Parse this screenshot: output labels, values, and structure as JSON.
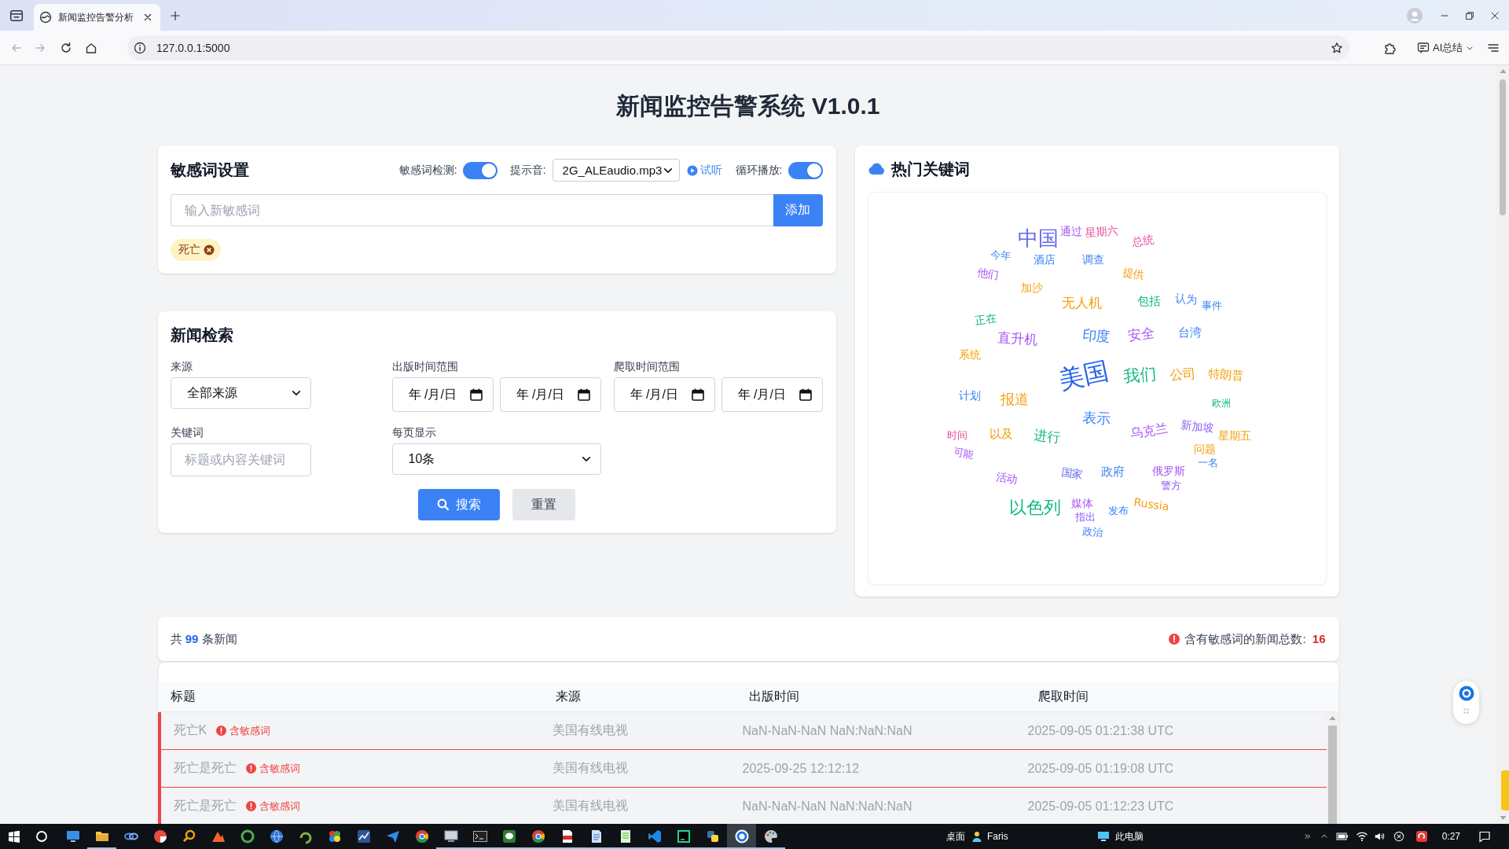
{
  "browser": {
    "tabs": [
      {
        "title": "新闻监控告警分析",
        "selected": true
      }
    ],
    "address": "127.0.0.1:5000",
    "ai_button": "AI总结"
  },
  "page_title": "新闻监控告警系统 V1.0.1",
  "sensitive_settings": {
    "title": "敏感词设置",
    "detection": {
      "label": "敏感词检测:",
      "on": true
    },
    "sound": {
      "label": "提示音:",
      "value": "2G_ALEaudio.mp3"
    },
    "preview": "试听",
    "loop": {
      "label": "循环播放:",
      "on": true
    },
    "new_word": {
      "placeholder": "输入新敏感词"
    },
    "add_button": "添加",
    "tags": [
      "死亡"
    ]
  },
  "hot_keywords": {
    "title": "热门关键词",
    "words": [
      {
        "text": "中国",
        "color": "#6366f1"
      },
      {
        "text": "通过",
        "color": "#a855f7"
      },
      {
        "text": "星期六",
        "color": "#ec4899"
      },
      {
        "text": "总统",
        "color": "#ec4899"
      },
      {
        "text": "今年",
        "color": "#3b82f6"
      },
      {
        "text": "酒店",
        "color": "#3b82f6"
      },
      {
        "text": "调查",
        "color": "#3b82f6"
      },
      {
        "text": "他们",
        "color": "#a855f7"
      },
      {
        "text": "提供",
        "color": "#f59e0b"
      },
      {
        "text": "加沙",
        "color": "#f59e0b"
      },
      {
        "text": "无人机",
        "color": "#f59e0b"
      },
      {
        "text": "包括",
        "color": "#10b981"
      },
      {
        "text": "认为",
        "color": "#3b82f6"
      },
      {
        "text": "事件",
        "color": "#3b82f6"
      },
      {
        "text": "正在",
        "color": "#10b981"
      },
      {
        "text": "直升机",
        "color": "#a855f7"
      },
      {
        "text": "印度",
        "color": "#3b82f6"
      },
      {
        "text": "安全",
        "color": "#a855f7"
      },
      {
        "text": "台湾",
        "color": "#3b82f6"
      },
      {
        "text": "系统",
        "color": "#f59e0b"
      },
      {
        "text": "美国",
        "color": "#2563eb"
      },
      {
        "text": "我们",
        "color": "#10b981"
      },
      {
        "text": "公司",
        "color": "#f59e0b"
      },
      {
        "text": "特朗普",
        "color": "#f59e0b"
      },
      {
        "text": "计划",
        "color": "#3b82f6"
      },
      {
        "text": "报道",
        "color": "#f59e0b"
      },
      {
        "text": "欧洲",
        "color": "#10b981"
      },
      {
        "text": "表示",
        "color": "#3b82f6"
      },
      {
        "text": "时间",
        "color": "#ec4899"
      },
      {
        "text": "以及",
        "color": "#f59e0b"
      },
      {
        "text": "进行",
        "color": "#10b981"
      },
      {
        "text": "乌克兰",
        "color": "#a855f7"
      },
      {
        "text": "新加坡",
        "color": "#8b5cf6"
      },
      {
        "text": "星期五",
        "color": "#f59e0b"
      },
      {
        "text": "可能",
        "color": "#a855f7"
      },
      {
        "text": "问题",
        "color": "#f59e0b"
      },
      {
        "text": "一名",
        "color": "#3b82f6"
      },
      {
        "text": "活动",
        "color": "#a855f7"
      },
      {
        "text": "国家",
        "color": "#6366f1"
      },
      {
        "text": "政府",
        "color": "#3b82f6"
      },
      {
        "text": "俄罗斯",
        "color": "#a855f7"
      },
      {
        "text": "警方",
        "color": "#8b5cf6"
      },
      {
        "text": "以色列",
        "color": "#10b981"
      },
      {
        "text": "媒体",
        "color": "#a855f7"
      },
      {
        "text": "发布",
        "color": "#3b82f6"
      },
      {
        "text": "Russia",
        "color": "#f59e0b"
      },
      {
        "text": "指出",
        "color": "#8b5cf6"
      },
      {
        "text": "政治",
        "color": "#3b82f6"
      }
    ]
  },
  "news_search": {
    "title": "新闻检索",
    "source": {
      "label": "来源",
      "value": "全部来源"
    },
    "publish_range": {
      "label": "出版时间范围",
      "from": {
        "placeholder": "年 /月/日"
      },
      "to": {
        "placeholder": "年 /月/日"
      }
    },
    "crawl_range": {
      "label": "爬取时间范围",
      "from": {
        "placeholder": "年 /月/日"
      },
      "to": {
        "placeholder": "年 /月/日"
      }
    },
    "keyword": {
      "label": "关键词",
      "placeholder": "标题或内容关键词"
    },
    "page_size": {
      "label": "每页显示",
      "value": "10条"
    },
    "buttons": [
      {
        "label": "搜索",
        "kind": "primary"
      },
      {
        "label": "重置",
        "kind": "secondary"
      }
    ]
  },
  "summary": {
    "total_text": "共 **99** 条新闻",
    "sensitive_text": "含有敏感词的新闻总数: **16**"
  },
  "news_table": {
    "columns": [
      "标题",
      "来源",
      "出版时间",
      "爬取时间"
    ],
    "rows": [
      {
        "title": "死亡K",
        "flag": "含敏感词",
        "sensitive": true,
        "source": "美国有线电视",
        "published": "NaN-NaN-NaN NaN:NaN:NaN",
        "crawled": "2025-09-05 01:21:38 UTC"
      },
      {
        "title": "死亡是死亡",
        "flag": "含敏感词",
        "sensitive": true,
        "source": "美国有线电视",
        "published": "2025-09-25 12:12:12",
        "crawled": "2025-09-05 01:19:08 UTC"
      },
      {
        "title": "死亡是死亡",
        "flag": "含敏感词",
        "sensitive": true,
        "source": "美国有线电视",
        "published": "NaN-NaN-NaN NaN:NaN:NaN",
        "crawled": "2025-09-05 01:12:23 UTC"
      }
    ]
  },
  "taskbar": {
    "apps": [
      {
        "kind": "monitor",
        "running": false,
        "selected": false
      },
      {
        "kind": "folder",
        "running": true,
        "selected": false
      },
      {
        "kind": "chain",
        "running": false,
        "selected": false
      },
      {
        "kind": "pie",
        "running": false,
        "selected": false
      },
      {
        "kind": "magnifier",
        "running": false,
        "selected": false
      },
      {
        "kind": "peak",
        "running": false,
        "selected": false
      },
      {
        "kind": "ring",
        "running": false,
        "selected": false
      },
      {
        "kind": "globe",
        "running": false,
        "selected": false
      },
      {
        "kind": "swirl",
        "running": false,
        "selected": false
      },
      {
        "kind": "flower",
        "running": false,
        "selected": false
      },
      {
        "kind": "chart",
        "running": false,
        "selected": false
      },
      {
        "kind": "plane",
        "running": false,
        "selected": false
      },
      {
        "kind": "wheel",
        "running": false,
        "selected": false
      },
      {
        "kind": "screen",
        "running": true,
        "selected": false
      },
      {
        "kind": "terminal",
        "running": true,
        "selected": false
      },
      {
        "kind": "chat",
        "running": true,
        "selected": false
      },
      {
        "kind": "wheel",
        "running": true,
        "selected": false
      },
      {
        "kind": "document",
        "running": true,
        "selected": false
      },
      {
        "kind": "page",
        "running": true,
        "selected": false
      },
      {
        "kind": "notepad",
        "running": true,
        "selected": false
      },
      {
        "kind": "ribbon",
        "running": true,
        "selected": false
      },
      {
        "kind": "tile",
        "running": true,
        "selected": false
      },
      {
        "kind": "squares",
        "running": true,
        "selected": false
      },
      {
        "kind": "target",
        "running": true,
        "selected": true
      },
      {
        "kind": "palette",
        "running": true,
        "selected": false
      }
    ],
    "desktop_label": "桌面",
    "user": "Faris",
    "computer_label": "此电脑",
    "clock": "0:27"
  }
}
